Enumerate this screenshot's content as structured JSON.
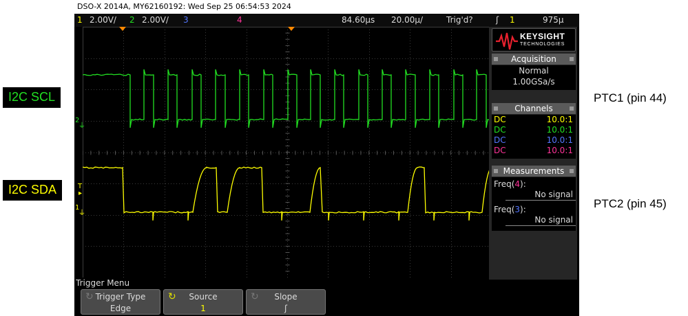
{
  "annotations": {
    "scl_label": "I2C SCL",
    "sda_label": "I2C SDA",
    "ptc1_label": "PTC1 (pin 44)",
    "ptc2_label": "PTC2 (pin 45)"
  },
  "scope": {
    "title": "DSO-X 2014A, MY62160192: Wed Sep 25 06:54:53 2024",
    "status": {
      "ch1_num": "1",
      "ch1_scale": "2.00V/",
      "ch2_num": "2",
      "ch2_scale": "2.00V/",
      "ch3_num": "3",
      "ch4_num": "4",
      "time_delay": "84.60µs",
      "time_scale": "20.00µ/",
      "trigger_state": "Trig'd?",
      "trigger_slope_glyph": "ʃ",
      "trigger_source": "1",
      "trigger_level": "975µ"
    },
    "colors": {
      "ch1": "#ffff00",
      "ch2": "#22e022",
      "ch3": "#5577ff",
      "ch4": "#ff3399",
      "trigger_marker": "#ff8800"
    },
    "channel_markers": {
      "ch2": "2",
      "trigger": "T",
      "ch1": "1"
    },
    "side": {
      "brand": "KEYSIGHT",
      "brand_sub": "TECHNOLOGIES",
      "acquisition": {
        "header": "Acquisition",
        "mode": "Normal",
        "rate": "1.00GSa/s"
      },
      "channels": {
        "header": "Channels",
        "rows": [
          {
            "coupling": "DC",
            "ratio": "10.0:1",
            "color": "#ffff00"
          },
          {
            "coupling": "DC",
            "ratio": "10.0:1",
            "color": "#22e022"
          },
          {
            "coupling": "DC",
            "ratio": "10.0:1",
            "color": "#5577ff"
          },
          {
            "coupling": "DC",
            "ratio": "10.0:1",
            "color": "#ff3399"
          }
        ]
      },
      "measurements": {
        "header": "Measurements",
        "items": [
          {
            "label_pre": "Freq(",
            "source": "4",
            "label_post": "):",
            "value": "No signal",
            "source_color": "#ff3399"
          },
          {
            "label_pre": "Freq(",
            "source": "3",
            "label_post": "):",
            "value": "No signal",
            "source_color": "#5577ff"
          }
        ]
      }
    },
    "menu": {
      "title": "Trigger Menu",
      "softkeys": [
        {
          "label": "Trigger Type",
          "value": "Edge"
        },
        {
          "label": "Source",
          "value": "1"
        },
        {
          "label": "Slope",
          "value": "ʃ"
        }
      ]
    }
  }
}
